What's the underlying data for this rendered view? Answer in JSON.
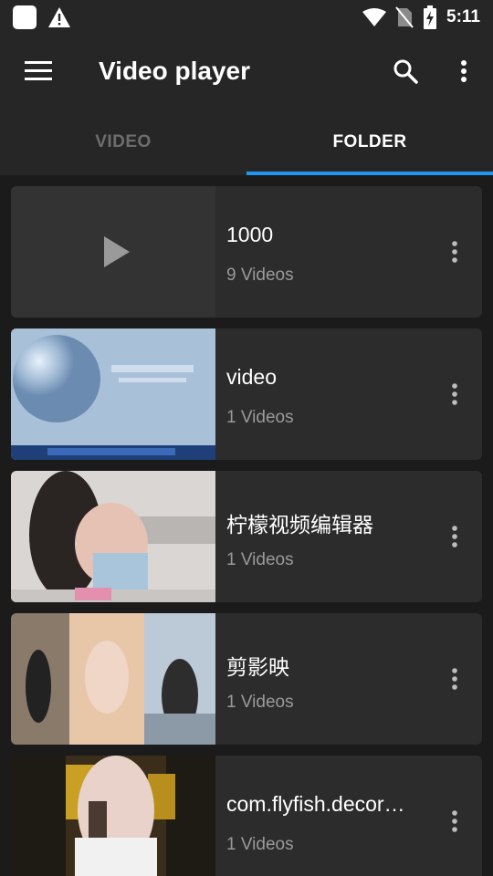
{
  "status_bar": {
    "time": "5:11",
    "icons": [
      "app-square-icon",
      "warning-icon",
      "wifi-icon",
      "no-sim-icon",
      "battery-charging-icon"
    ]
  },
  "app_bar": {
    "title": "Video player",
    "icons": [
      "menu-icon",
      "search-icon",
      "more-vert-icon"
    ]
  },
  "tabs": [
    {
      "label": "VIDEO",
      "selected": false
    },
    {
      "label": "FOLDER",
      "selected": true
    }
  ],
  "colors": {
    "background": "#1b1b1b",
    "bar": "#262626",
    "card": "#2c2c2c",
    "accent": "#2196f3",
    "subtext": "#9a9a9a"
  },
  "folders": [
    {
      "name": "1000",
      "count": "9 Videos",
      "thumbnail": "play-placeholder-icon"
    },
    {
      "name": "video",
      "count": "1 Videos",
      "thumbnail": "blue-globe-screenshot"
    },
    {
      "name": "柠檬视频编辑器",
      "count": "1 Videos",
      "thumbnail": "blurred-photo"
    },
    {
      "name": "剪影映",
      "count": "1 Videos",
      "thumbnail": "photo-collage"
    },
    {
      "name": "com.flyfish.decor…",
      "count": "1 Videos",
      "thumbnail": "pixelated-photo"
    }
  ]
}
